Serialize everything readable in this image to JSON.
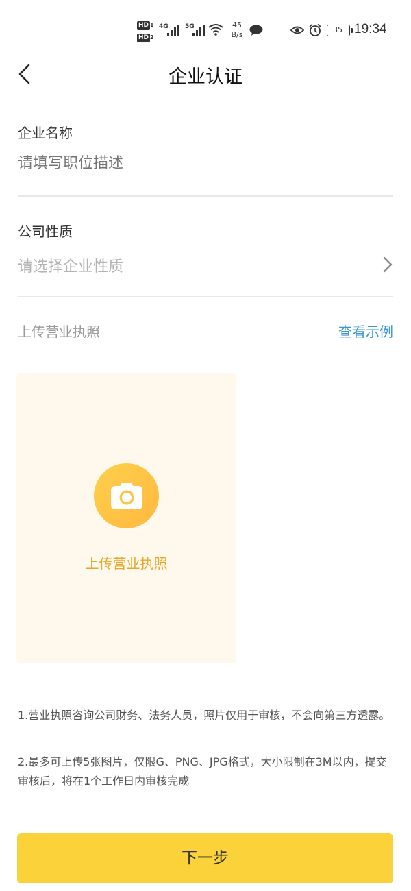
{
  "status_bar": {
    "hd1": "HD",
    "hd1_sub": "1",
    "hd2": "HD",
    "hd2_sub": "2",
    "net1": "4G",
    "net2": "5G",
    "speed_value": "45",
    "speed_unit": "B/s",
    "battery": "35",
    "time": "19:34"
  },
  "header": {
    "title": "企业认证"
  },
  "form": {
    "company_name_label": "企业名称",
    "company_name_placeholder": "请填写职位描述",
    "company_type_label": "公司性质",
    "company_type_placeholder": "请选择企业性质"
  },
  "license": {
    "section_label": "上传营业执照",
    "example_link": "查看示例",
    "upload_label": "上传营业执照"
  },
  "notes": [
    "1.营业执照咨询公司财务、法务人员，照片仅用于审核，不会向第三方透露。",
    "2.最多可上传5张图片，仅限G、PNG、JPG格式，大小限制在3M以内，提交审核后，将在1个工作日内审核完成"
  ],
  "next_button": "下一步",
  "colors": {
    "accent_yellow": "#fcd23a",
    "link_blue": "#3a97d4",
    "upload_bg": "#fff8ec",
    "upload_text": "#e6a82a"
  },
  "icons": [
    "back-icon",
    "chevron-right-icon",
    "camera-icon",
    "wifi-icon",
    "chat-icon",
    "eye-icon",
    "alarm-icon",
    "battery-icon"
  ]
}
